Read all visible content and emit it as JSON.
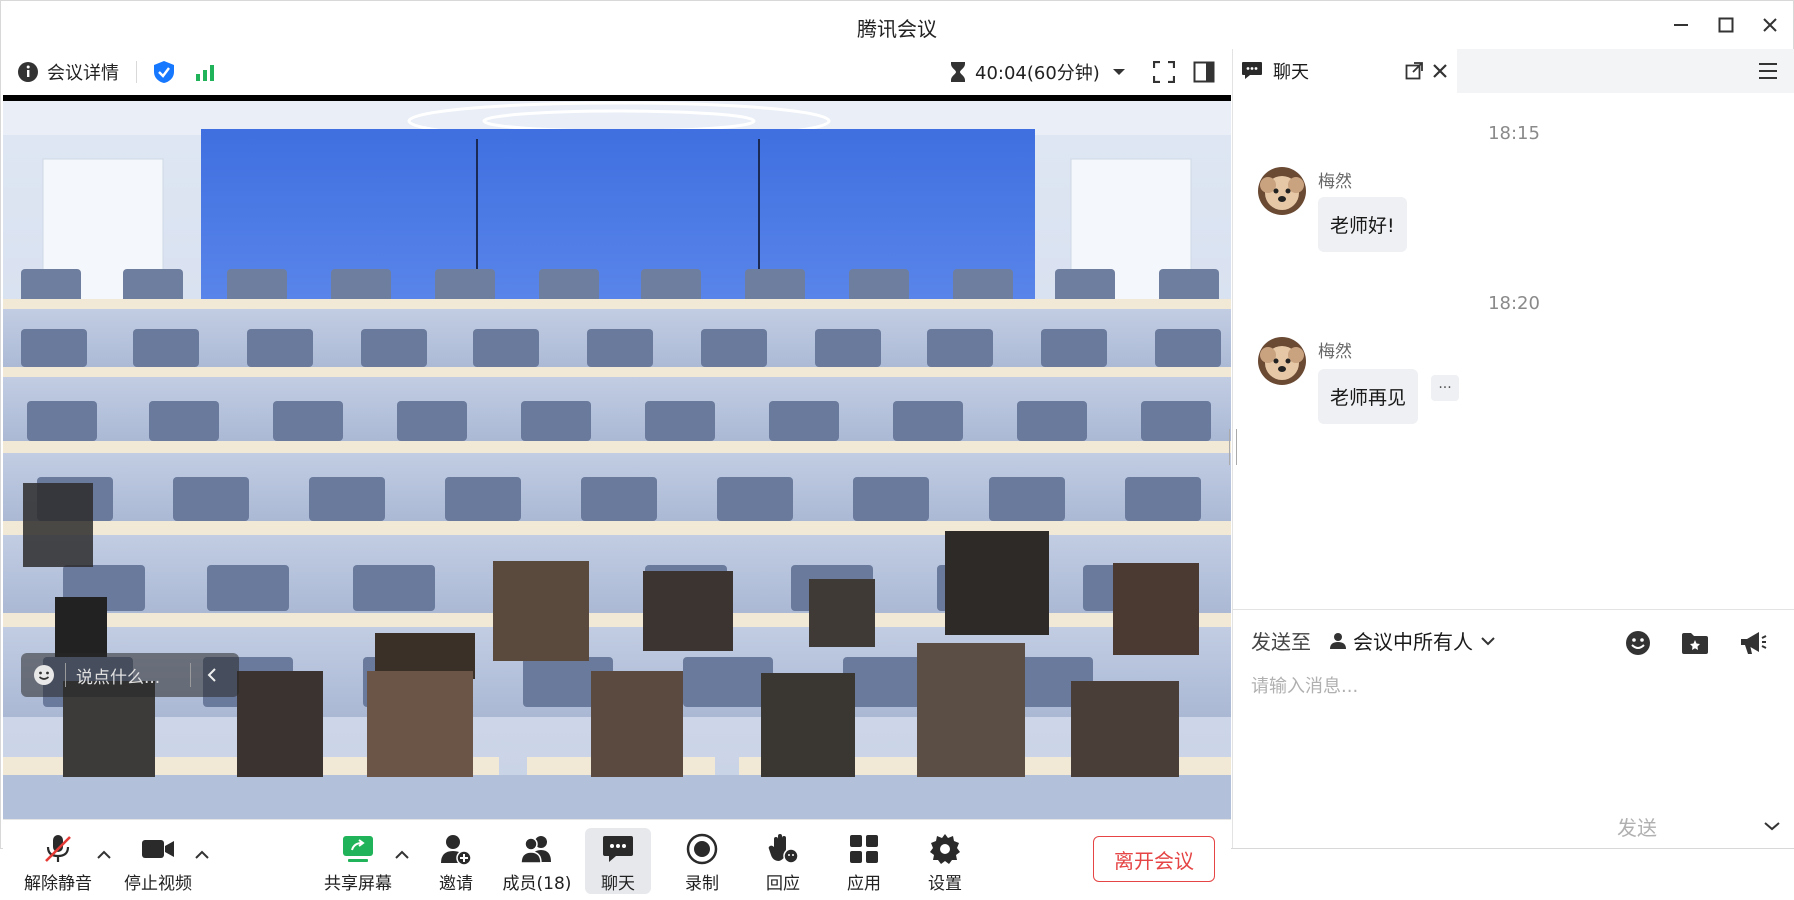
{
  "window": {
    "title": "腾讯会议",
    "controls": [
      "minimize",
      "maximize",
      "close"
    ]
  },
  "topbar": {
    "meeting_info": "会议详情",
    "timer": "40:04(60分钟)"
  },
  "video": {
    "chat_input_placeholder": "说点什么..."
  },
  "toolbar": {
    "unmute": "解除静音",
    "stop_video": "停止视频",
    "share_screen": "共享屏幕",
    "invite": "邀请",
    "members": "成员(18)",
    "chat": "聊天",
    "record": "录制",
    "reactions": "回应",
    "apps": "应用",
    "settings": "设置",
    "leave": "离开会议"
  },
  "chat": {
    "tab_title": "聊天",
    "messages": [
      {
        "time": "18:15",
        "sender": "梅然",
        "text": "老师好!"
      },
      {
        "time": "18:20",
        "sender": "梅然",
        "text": "老师再见"
      }
    ],
    "more_glyph": "···",
    "send_to_label": "发送至",
    "recipient": "会议中所有人",
    "input_placeholder": "请输入消息...",
    "send_label": "发送"
  },
  "colors": {
    "accent_blue": "#1677ff",
    "green_signal": "#21b35a",
    "leave_red": "#e54545",
    "share_green": "#21b35a"
  }
}
